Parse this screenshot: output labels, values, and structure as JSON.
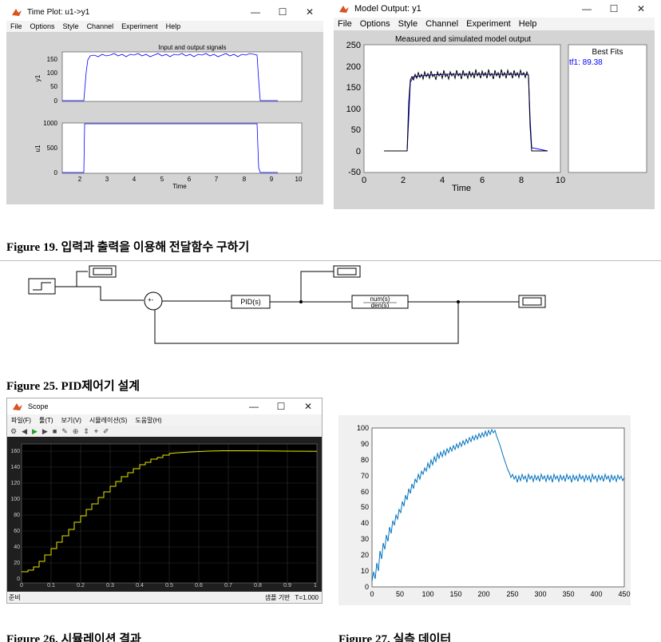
{
  "fig19": {
    "window1": {
      "title": "Time Plot: u1->y1",
      "menu": [
        "File",
        "Options",
        "Style",
        "Channel",
        "Experiment",
        "Help"
      ],
      "top_title": "Input and output signals",
      "top_ylabel": "y1",
      "top_yticks": [
        "150",
        "100",
        "50",
        "0"
      ],
      "bottom_ylabel": "u1",
      "bottom_yticks": [
        "1000",
        "500",
        "0"
      ],
      "xticks": [
        "2",
        "3",
        "4",
        "5",
        "6",
        "7",
        "8",
        "9",
        "10"
      ],
      "xlabel": "Time"
    },
    "window2": {
      "title": "Model Output: y1",
      "menu": [
        "File",
        "Options",
        "Style",
        "Channel",
        "Experiment",
        "Help"
      ],
      "plot_title": "Measured and simulated model output",
      "yticks": [
        "250",
        "200",
        "150",
        "100",
        "50",
        "0",
        "-50"
      ],
      "xticks": [
        "0",
        "2",
        "4",
        "6",
        "8",
        "10"
      ],
      "xlabel": "Time",
      "bestfits_title": "Best Fits",
      "bestfits_entry": "tf1: 89.38",
      "bestfits_color": "#0000ff"
    },
    "caption_num": "Figure 19.",
    "caption_text": "입력과 출력을 이용해 전달함수 구하기"
  },
  "fig25": {
    "pid_label": "PID(s)",
    "tf_num": "num(s)",
    "tf_den": "den(s)",
    "sum_signs": "+-",
    "caption_num": "Figure 25.",
    "caption_text": "PID제어기 설계"
  },
  "fig26": {
    "title": "Scope",
    "menu": [
      "파일(F)",
      "툴(T)",
      "보기(V)",
      "시뮬레이션(S)",
      "도움말(H)"
    ],
    "yticks": [
      "160",
      "140",
      "120",
      "100",
      "80",
      "60",
      "40",
      "20",
      "0"
    ],
    "xticks": [
      "0",
      "0.1",
      "0.2",
      "0.3",
      "0.4",
      "0.5",
      "0.6",
      "0.7",
      "0.8",
      "0.9",
      "1"
    ],
    "status_left": "준비",
    "status_mid": "샘플 기반",
    "status_right": "T=1.000",
    "trace_color": "#e6e600",
    "caption_num": "Figure 26.",
    "caption_text": "시뮬레이션 결과"
  },
  "fig27": {
    "yticks": [
      "100",
      "90",
      "80",
      "70",
      "60",
      "50",
      "40",
      "30",
      "20",
      "10",
      "0"
    ],
    "xticks": [
      "0",
      "50",
      "100",
      "150",
      "200",
      "250",
      "300",
      "350",
      "400",
      "450"
    ],
    "line_color": "#0072bd",
    "caption_num": "Figure 27.",
    "caption_text": "실측 데이터"
  }
}
